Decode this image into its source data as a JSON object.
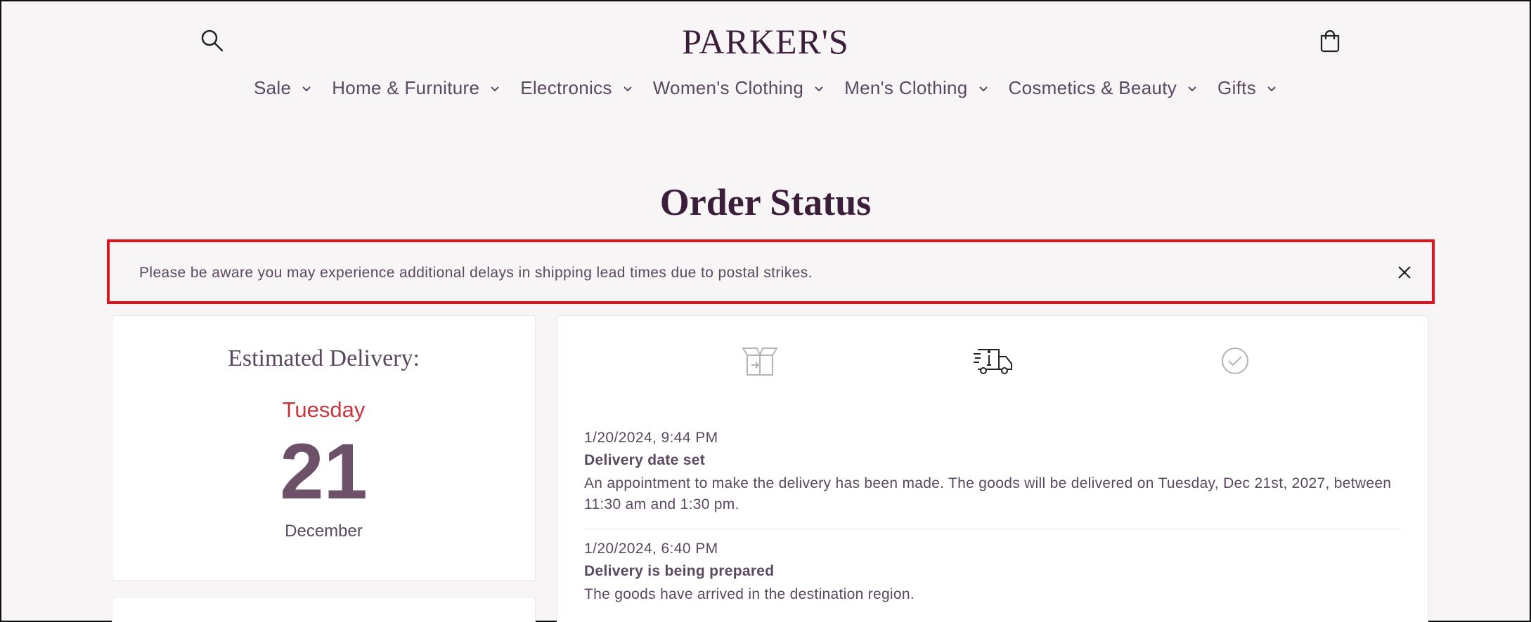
{
  "header": {
    "logo": "PARKER'S",
    "search_icon": "search-icon",
    "cart_icon": "shopping-bag-icon"
  },
  "nav": {
    "items": [
      {
        "label": "Sale"
      },
      {
        "label": "Home & Furniture"
      },
      {
        "label": "Electronics"
      },
      {
        "label": "Women's Clothing"
      },
      {
        "label": "Men's Clothing"
      },
      {
        "label": "Cosmetics & Beauty"
      },
      {
        "label": "Gifts"
      }
    ]
  },
  "page": {
    "title": "Order Status"
  },
  "notice": {
    "text": "Please be aware you may experience additional delays in shipping lead times due to postal strikes.",
    "close_icon": "close-icon",
    "border_color": "#e0121b"
  },
  "delivery": {
    "title": "Estimated Delivery:",
    "weekday": "Tuesday",
    "day": "21",
    "month": "December",
    "weekday_color": "#c9353e"
  },
  "timeline": {
    "steps": [
      {
        "icon": "package-icon",
        "state": "done"
      },
      {
        "icon": "delivery-truck-icon",
        "state": "current"
      },
      {
        "icon": "check-circle-icon",
        "state": "pending"
      }
    ],
    "events": [
      {
        "time": "1/20/2024, 9:44 PM",
        "title": "Delivery date set",
        "description": "An appointment to make the delivery has been made. The goods will be delivered on Tuesday, Dec 21st, 2027, between 11:30 am and 1:30 pm."
      },
      {
        "time": "1/20/2024, 6:40 PM",
        "title": "Delivery is being prepared",
        "description": "The goods have arrived in the destination region."
      }
    ]
  }
}
